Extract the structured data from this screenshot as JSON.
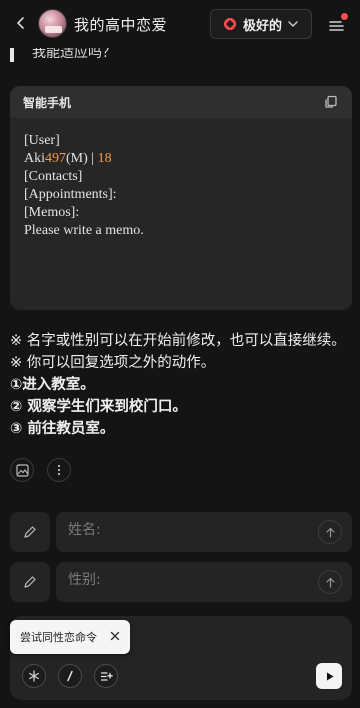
{
  "header": {
    "title": "我的高中恋爱",
    "model_label": "极好的",
    "accent_color": "#ff4b4b"
  },
  "chat": {
    "quote_text": "我能适应吗？",
    "card": {
      "title": "智能手机",
      "user_header": "[User]",
      "user_name_prefix": "Aki",
      "user_number": "497",
      "user_gender": "(M)",
      "user_sep": " | ",
      "user_age": "18",
      "contacts_header": "[Contacts]",
      "appointments_header": "[Appointments]:",
      "memos_header": "[Memos]:",
      "memos_text": "Please write a memo."
    },
    "notes": [
      "※ 名字或性别可以在开始前修改，也可以直接继续。",
      "※ 你可以回复选项之外的动作。"
    ],
    "options": [
      "①进入教室。",
      "② 观察学生们来到校门口。",
      "③ 前往教员室。"
    ]
  },
  "fields": {
    "name_placeholder": "姓名:",
    "gender_placeholder": "性别:"
  },
  "composer": {
    "tooltip_text": "尝试同性恋命令"
  },
  "icons": {
    "back": "chevron-left-icon",
    "model": "flower-icon",
    "menu": "menu-icon",
    "copy": "copy-icon",
    "image": "image-icon",
    "more": "more-icon",
    "edit": "pencil-icon",
    "send": "arrow-up-icon",
    "asterisk": "asterisk-icon",
    "slash": "slash-icon",
    "command": "command-list-icon",
    "play": "play-icon",
    "close": "close-icon"
  }
}
